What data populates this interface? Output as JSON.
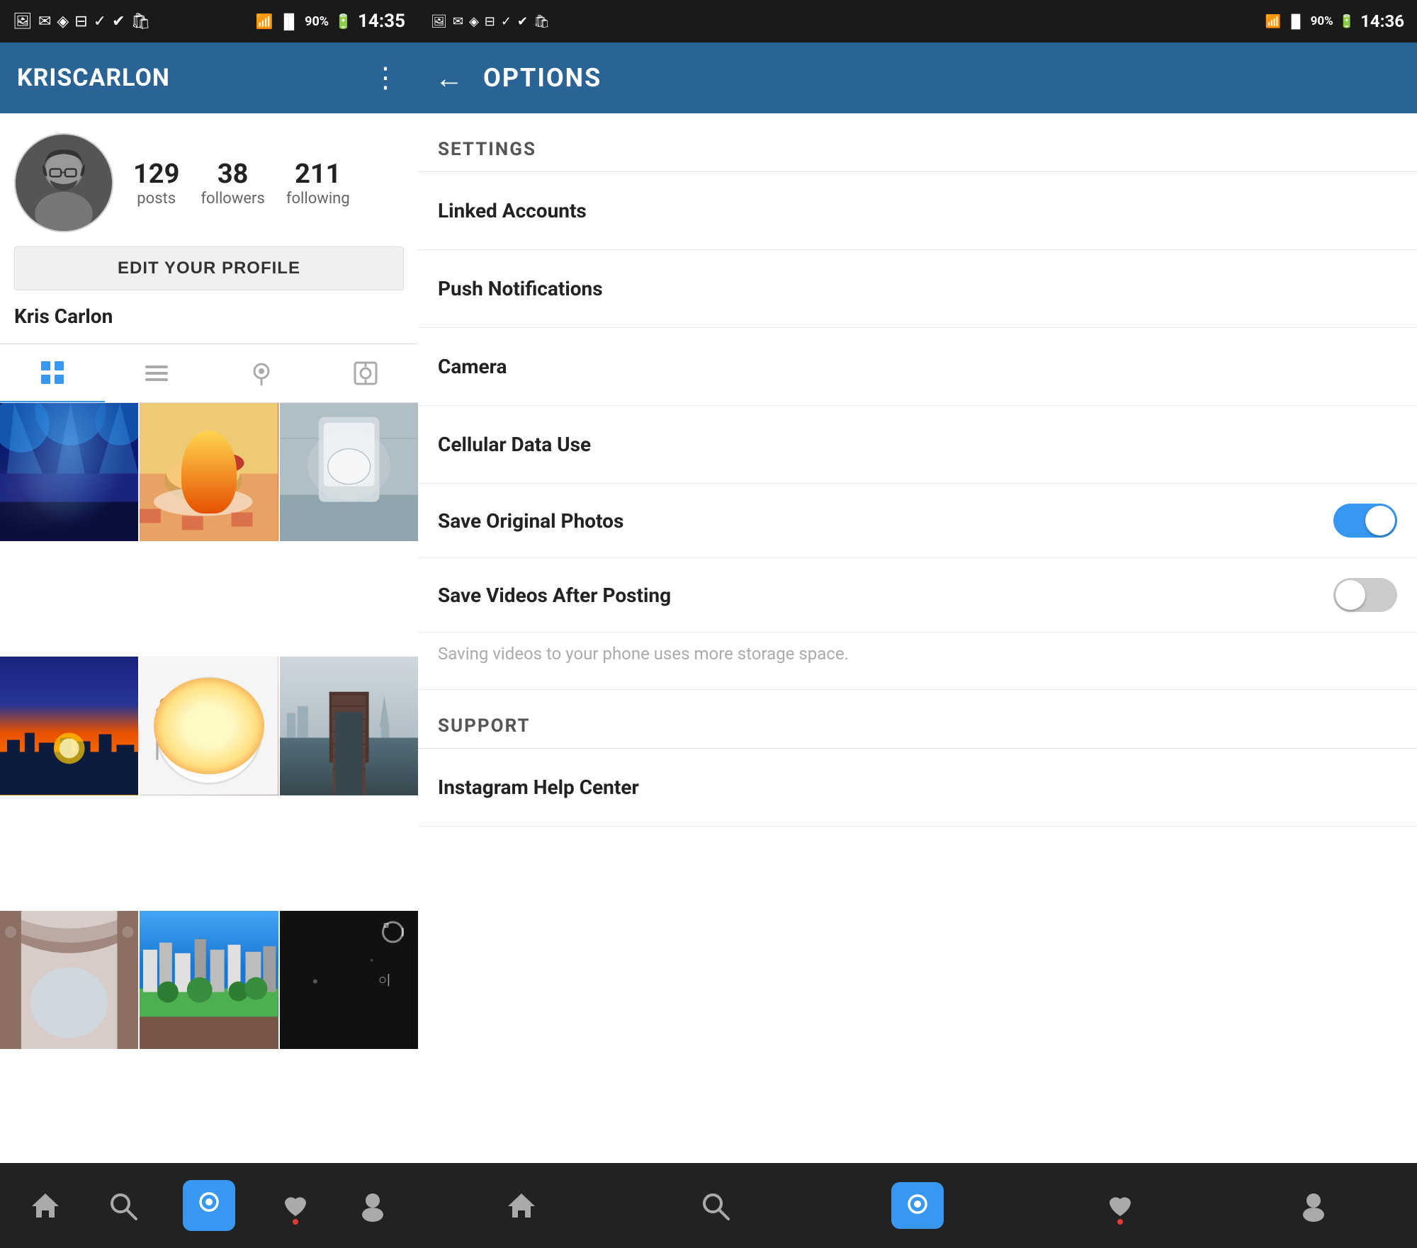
{
  "left": {
    "statusBar": {
      "time": "14:35",
      "battery": "90%",
      "signal": "●●●"
    },
    "topBar": {
      "title": "KRISCARLON",
      "menuIcon": "⋮"
    },
    "profile": {
      "name": "Kris Carlon",
      "stats": {
        "posts": {
          "count": "129",
          "label": "posts"
        },
        "followers": {
          "count": "38",
          "label": "followers"
        },
        "following": {
          "count": "211",
          "label": "following"
        }
      },
      "editButton": "EDIT YOUR PROFILE"
    },
    "tabs": [
      {
        "id": "grid",
        "icon": "⊞",
        "active": true
      },
      {
        "id": "list",
        "icon": "≡",
        "active": false
      },
      {
        "id": "map",
        "icon": "◎",
        "active": false
      },
      {
        "id": "tagged",
        "icon": "▣",
        "active": false
      }
    ],
    "bottomNav": [
      {
        "id": "home",
        "icon": "⌂",
        "active": false,
        "dot": false
      },
      {
        "id": "search",
        "icon": "🔍",
        "active": false,
        "dot": false
      },
      {
        "id": "camera",
        "icon": "○",
        "active": true,
        "dot": false
      },
      {
        "id": "heart",
        "icon": "♥",
        "active": false,
        "dot": true
      },
      {
        "id": "person",
        "icon": "👤",
        "active": false,
        "dot": false
      }
    ]
  },
  "right": {
    "statusBar": {
      "time": "14:36",
      "battery": "90%"
    },
    "optionsBar": {
      "backIcon": "←",
      "title": "OPTIONS"
    },
    "settings": {
      "sectionLabel": "SETTINGS",
      "items": [
        {
          "id": "linked-accounts",
          "label": "Linked Accounts",
          "type": "link"
        },
        {
          "id": "push-notifications",
          "label": "Push Notifications",
          "type": "link"
        },
        {
          "id": "camera",
          "label": "Camera",
          "type": "link"
        },
        {
          "id": "cellular-data",
          "label": "Cellular Data Use",
          "type": "link"
        },
        {
          "id": "save-original",
          "label": "Save Original Photos",
          "type": "toggle",
          "enabled": true
        },
        {
          "id": "save-videos",
          "label": "Save Videos After Posting",
          "type": "toggle",
          "enabled": false
        }
      ],
      "helperText": "Saving videos to your phone uses more storage space."
    },
    "support": {
      "sectionLabel": "SUPPORT",
      "items": [
        {
          "id": "help-center",
          "label": "Instagram Help Center",
          "type": "link"
        }
      ]
    },
    "bottomNav": [
      {
        "id": "home",
        "icon": "⌂",
        "dot": false
      },
      {
        "id": "search",
        "icon": "🔍",
        "dot": false
      },
      {
        "id": "camera",
        "icon": "○",
        "active": true,
        "dot": false
      },
      {
        "id": "heart",
        "icon": "♥",
        "dot": true
      },
      {
        "id": "person",
        "icon": "👤",
        "dot": false
      }
    ]
  }
}
